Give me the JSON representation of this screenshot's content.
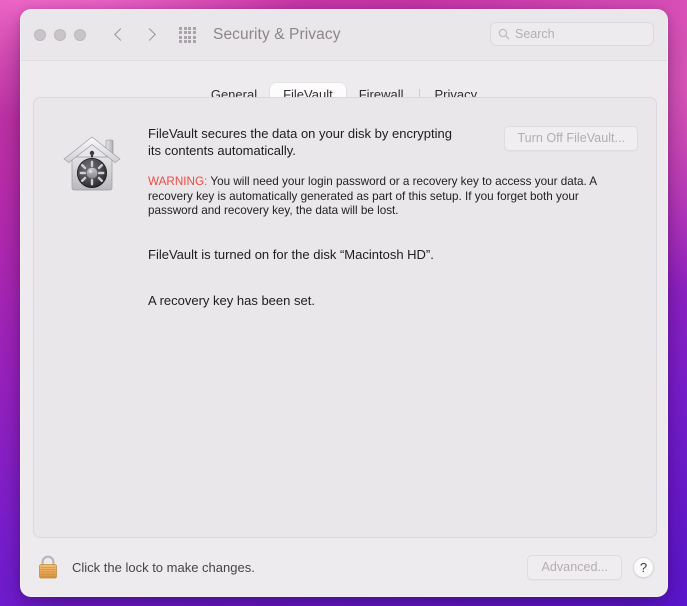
{
  "desktop": {
    "wallpaper_colors": [
      "#d23ea8",
      "#a324c4",
      "#5c17d6"
    ]
  },
  "window": {
    "title": "Security & Privacy",
    "traffic_lights": [
      "close-button",
      "minimize-button",
      "zoom-button"
    ],
    "nav": {
      "back_icon": "chevron-left-icon",
      "forward_icon": "chevron-right-icon"
    },
    "grid_icon": "app-grid-icon",
    "search": {
      "placeholder": "Search",
      "value": "",
      "icon": "search-icon"
    }
  },
  "tabs": [
    {
      "label": "General",
      "active": false
    },
    {
      "label": "FileVault",
      "active": true
    },
    {
      "label": "Firewall",
      "active": false
    },
    {
      "label": "Privacy",
      "active": false
    }
  ],
  "filevault": {
    "icon_name": "filevault-house-safe-icon",
    "lead_text": "FileVault secures the data on your disk by encrypting its contents automatically.",
    "warning_label": "WARNING:",
    "warning_text": " You will need your login password or a recovery key to access your data. A recovery key is automatically generated as part of this setup. If you forget both your password and recovery key, the data will be lost.",
    "status_disk": "FileVault is turned on for the disk “Macintosh HD”.",
    "status_recovery_key": "A recovery key has been set.",
    "turn_off_button": "Turn Off FileVault...",
    "warning_color": "#ec4b42"
  },
  "footer": {
    "lock_icon": "padlock-locked-icon",
    "lock_text": "Click the lock to make changes.",
    "advanced_button": "Advanced...",
    "help_button": "?"
  }
}
